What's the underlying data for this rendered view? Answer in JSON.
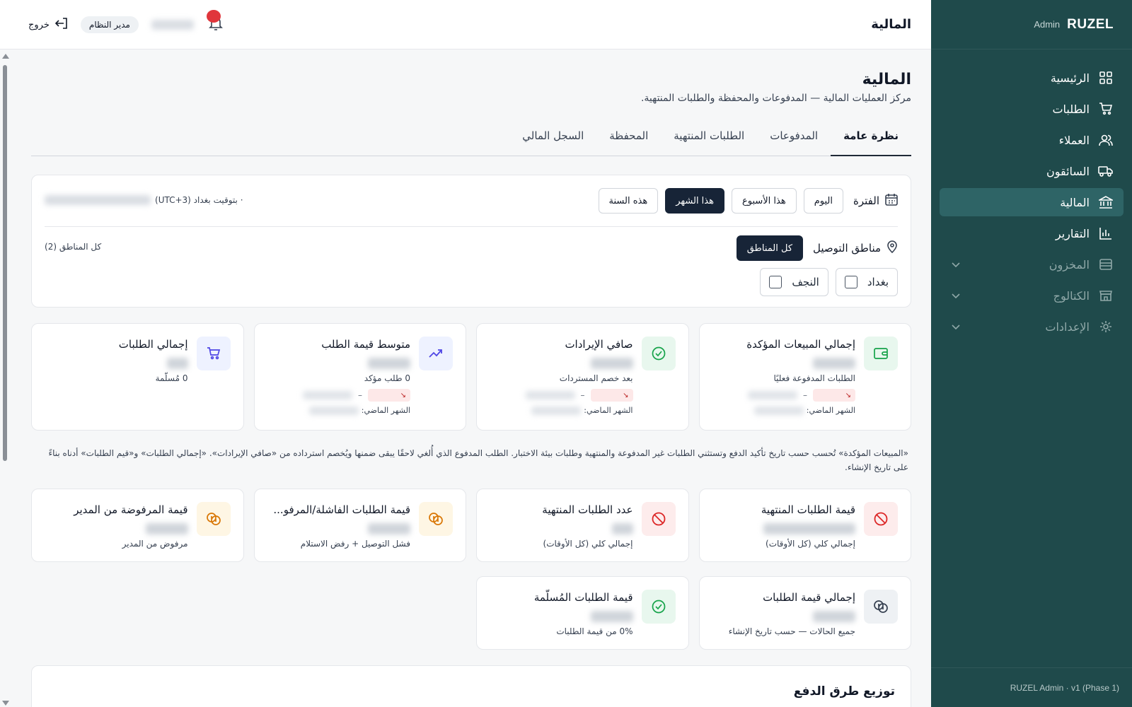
{
  "brand": {
    "logo": "RUZEL",
    "sub": "Admin"
  },
  "sidebar": {
    "items": [
      {
        "label": "الرئيسية",
        "icon": "dashboard-icon"
      },
      {
        "label": "الطلبات",
        "icon": "cart-icon"
      },
      {
        "label": "العملاء",
        "icon": "users-icon"
      },
      {
        "label": "السائقون",
        "icon": "truck-icon"
      },
      {
        "label": "المالية",
        "icon": "bank-icon",
        "active": true
      },
      {
        "label": "التقارير",
        "icon": "bar-chart-icon"
      },
      {
        "label": "المخزون",
        "icon": "archive-icon",
        "expandable": true
      },
      {
        "label": "الكتالوج",
        "icon": "store-icon",
        "expandable": true
      },
      {
        "label": "الإعدادات",
        "icon": "gear-icon",
        "expandable": true
      }
    ],
    "footer": "RUZEL Admin · v1 (Phase 1)"
  },
  "header": {
    "title": "المالية",
    "logout": "خروج",
    "role": "مدير النظام"
  },
  "page": {
    "title": "المالية",
    "subtitle": "مركز العمليات المالية — المدفوعات والمحفظة والطلبات المنتهية."
  },
  "tabs": [
    "نظرة عامة",
    "المدفوعات",
    "الطلبات المنتهية",
    "المحفظة",
    "السجل المالي"
  ],
  "filters": {
    "period_label": "الفترة",
    "periods": [
      "اليوم",
      "هذا الأسبوع",
      "هذا الشهر",
      "هذه السنة"
    ],
    "active_period": "هذا الشهر",
    "timezone": "· بتوقيت بغداد (UTC+3)",
    "zones_label": "مناطق التوصيل",
    "zones_all_button": "كل المناطق",
    "zones_all_count": "كل المناطق (2)",
    "zones": [
      "بغداد",
      "النجف"
    ]
  },
  "kpi": [
    {
      "title": "إجمالي المبيعات المؤكدة",
      "sub": "الطلبات المدفوعة فعليًا",
      "prev": "الشهر الماضي:",
      "icon": "wallet-icon",
      "tone": "green",
      "trend": true
    },
    {
      "title": "صافي الإيرادات",
      "sub": "بعد خصم المستردات",
      "prev": "الشهر الماضي:",
      "icon": "check-circle-icon",
      "tone": "green",
      "trend": true
    },
    {
      "title": "متوسط قيمة الطلب",
      "sub": "0 طلب مؤكد",
      "prev": "الشهر الماضي:",
      "icon": "trending-up-icon",
      "tone": "blue",
      "trend": true
    },
    {
      "title": "إجمالي الطلبات",
      "sub": "0 مُسلّمة",
      "prev": "",
      "icon": "cart-icon",
      "tone": "blue",
      "trend": false
    }
  ],
  "note": "«المبيعات المؤكدة» تُحسب حسب تاريخ تأكيد الدفع وتستثني الطلبات غير المدفوعة والمنتهية وطلبات بيئة الاختبار. الطلب المدفوع الذي أُلغي لاحقًا يبقى ضمنها ويُخصم استرداده من «صافي الإيرادات». «إجمالي الطلبات» و«قيم الطلبات» أدناه بناءً على تاريخ الإنشاء.",
  "cards2": [
    {
      "title": "قيمة الطلبات المنتهية",
      "sub": "إجمالي كلي (كل الأوقات)",
      "icon": "ban-icon",
      "tone": "red"
    },
    {
      "title": "عدد الطلبات المنتهية",
      "sub": "إجمالي كلي (كل الأوقات)",
      "icon": "ban-icon",
      "tone": "red"
    },
    {
      "title": "قيمة الطلبات الفاشلة/المرفو...",
      "sub": "فشل التوصيل + رفض الاستلام",
      "icon": "coins-icon",
      "tone": "amber"
    },
    {
      "title": "قيمة المرفوضة من المدير",
      "sub": "مرفوض من المدير",
      "icon": "coins-icon",
      "tone": "amber"
    }
  ],
  "cards3": [
    {
      "title": "إجمالي قيمة الطلبات",
      "sub": "جميع الحالات — حسب تاريخ الإنشاء",
      "icon": "coins-icon",
      "tone": "gray"
    },
    {
      "title": "قيمة الطلبات المُسلّمة",
      "sub": "0% من قيمة الطلبات",
      "icon": "check-circle-icon",
      "tone": "green"
    }
  ],
  "payments": {
    "title": "توزيع طرق الدفع"
  }
}
